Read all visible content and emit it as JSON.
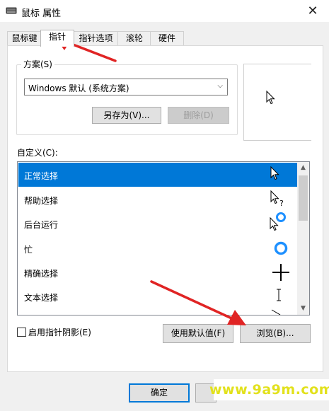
{
  "window": {
    "title": "鼠标 属性"
  },
  "tabs": [
    {
      "label": "鼠标键"
    },
    {
      "label": "指针"
    },
    {
      "label": "指针选项"
    },
    {
      "label": "滚轮"
    },
    {
      "label": "硬件"
    }
  ],
  "scheme": {
    "group_label": "方案(S)",
    "selected": "Windows 默认 (系统方案)",
    "save_as_label": "另存为(V)...",
    "delete_label": "删除(D)"
  },
  "custom": {
    "label": "自定义(C):",
    "rows": [
      {
        "label": "正常选择",
        "icon": "arrow-cursor-icon"
      },
      {
        "label": "帮助选择",
        "icon": "help-cursor-icon"
      },
      {
        "label": "后台运行",
        "icon": "working-in-background-cursor-icon"
      },
      {
        "label": "忙",
        "icon": "busy-cursor-icon"
      },
      {
        "label": "精确选择",
        "icon": "crosshair-cursor-icon"
      },
      {
        "label": "文本选择",
        "icon": "text-select-cursor-icon"
      }
    ],
    "selected_index": 0
  },
  "options": {
    "shadow_label": "启用指针阴影(E)",
    "shadow_checked": false
  },
  "buttons": {
    "use_default": "使用默认值(F)",
    "browse": "浏览(B)...",
    "ok": "确定"
  },
  "watermark": {
    "text": "www.9a9m.com"
  },
  "colors": {
    "selection": "#0078d7",
    "annotation_arrow": "#e02424",
    "watermark": "#e2e11c"
  }
}
